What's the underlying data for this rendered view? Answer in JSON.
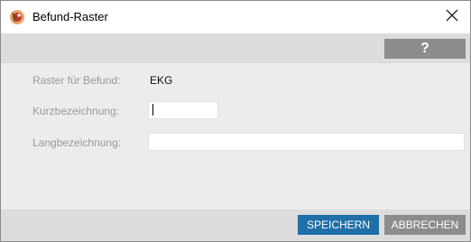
{
  "window": {
    "title": "Befund-Raster",
    "app_icon": "befund-app-icon",
    "close_icon": "close-icon"
  },
  "toolbar": {
    "help_label": "?"
  },
  "form": {
    "raster_label": "Raster für Befund:",
    "raster_value": "EKG",
    "kurz_label": "Kurzbezeichnung:",
    "kurz_value": "",
    "lang_label": "Langbezeichnung:",
    "lang_value": ""
  },
  "footer": {
    "save_label": "SPEICHERN",
    "cancel_label": "ABBRECHEN"
  },
  "colors": {
    "primary_button": "#1f6fa8",
    "secondary_button": "#8c8c8c",
    "panel_background": "#ececec",
    "bar_background": "#dcdcdc"
  }
}
